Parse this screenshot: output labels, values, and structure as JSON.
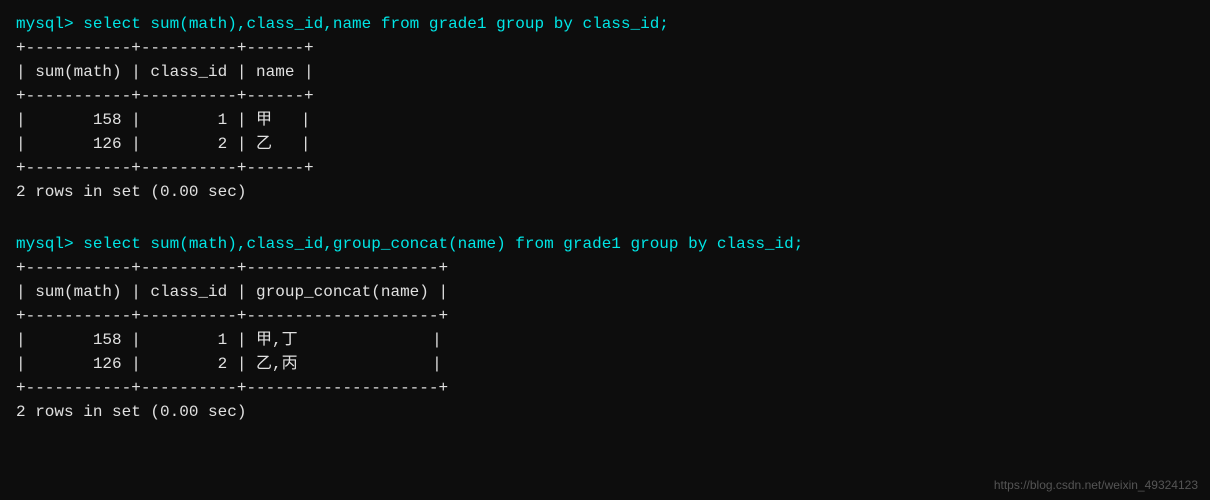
{
  "terminal": {
    "blocks": [
      {
        "id": "block1",
        "lines": [
          {
            "type": "cyan",
            "text": "mysql> select sum(math),class_id,name from grade1 group by class_id;"
          },
          {
            "type": "normal",
            "text": "+-----------+----------+------+"
          },
          {
            "type": "normal",
            "text": "| sum(math) | class_id | name |"
          },
          {
            "type": "normal",
            "text": "+-----------+----------+------+"
          },
          {
            "type": "normal",
            "text": "|       158 |        1 | 甲   |"
          },
          {
            "type": "normal",
            "text": "|       126 |        2 | 乙   |"
          },
          {
            "type": "normal",
            "text": "+-----------+----------+------+"
          },
          {
            "type": "normal",
            "text": "2 rows in set (0.00 sec)"
          }
        ]
      },
      {
        "id": "block2",
        "lines": [
          {
            "type": "cyan",
            "text": "mysql> select sum(math),class_id,group_concat(name) from grade1 group by class_id;"
          },
          {
            "type": "normal",
            "text": "+-----------+----------+--------------------+"
          },
          {
            "type": "normal",
            "text": "| sum(math) | class_id | group_concat(name) |"
          },
          {
            "type": "normal",
            "text": "+-----------+----------+--------------------+"
          },
          {
            "type": "normal",
            "text": "|       158 |        1 | 甲,丁              |"
          },
          {
            "type": "normal",
            "text": "|       126 |        2 | 乙,丙              |"
          },
          {
            "type": "normal",
            "text": "+-----------+----------+--------------------+"
          },
          {
            "type": "normal",
            "text": "2 rows in set (0.00 sec)"
          }
        ]
      }
    ],
    "watermark": "https://blog.csdn.net/weixin_49324123"
  }
}
